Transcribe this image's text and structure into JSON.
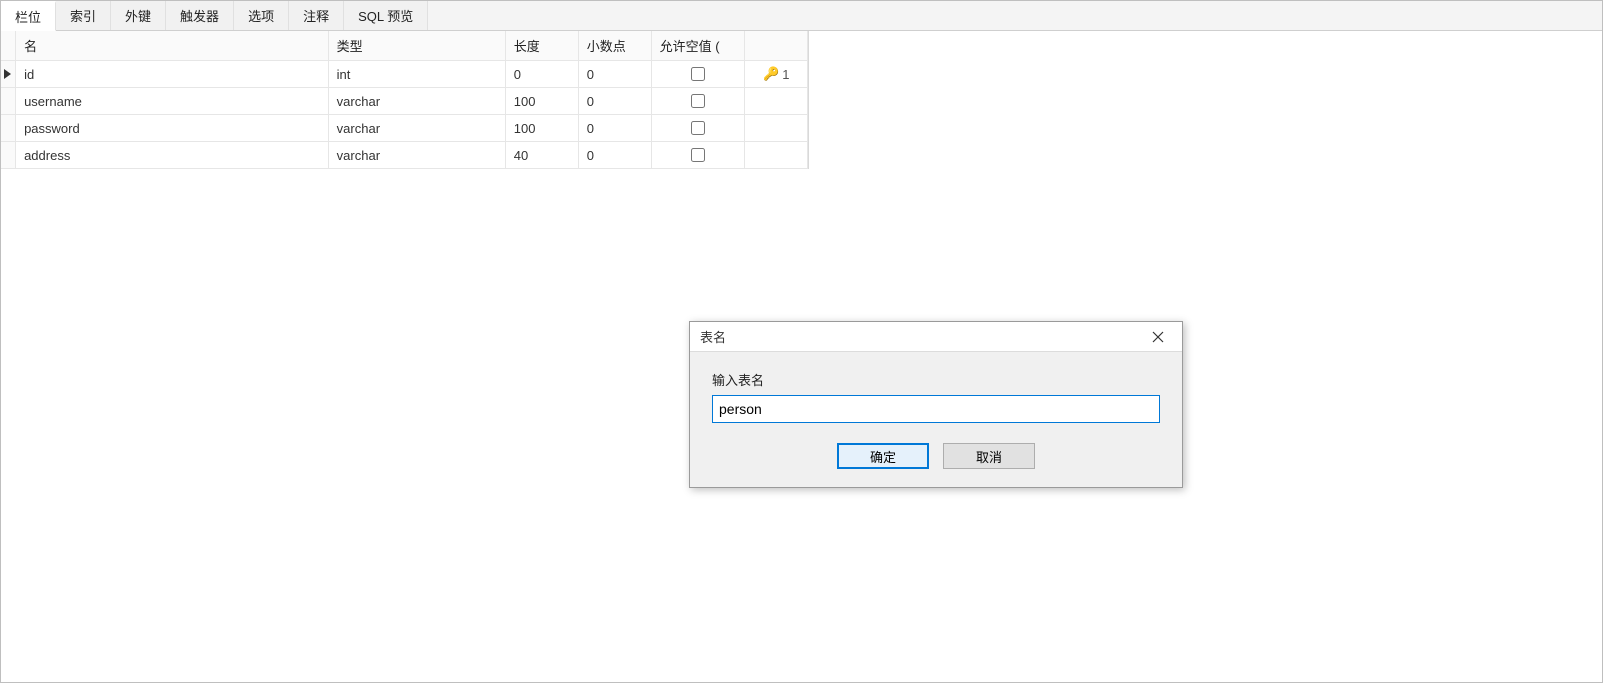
{
  "tabs": {
    "fields": "栏位",
    "indexes": "索引",
    "fkeys": "外键",
    "triggers": "触发器",
    "options": "选项",
    "comment": "注释",
    "sqlprev": "SQL 预览"
  },
  "columns": {
    "name": "名",
    "type": "类型",
    "length": "长度",
    "decimals": "小数点",
    "allow_null": "允许空值 ("
  },
  "rows": [
    {
      "name": "id",
      "type": "int",
      "length": "0",
      "decimals": "0",
      "allow_null": false,
      "pk": "1"
    },
    {
      "name": "username",
      "type": "varchar",
      "length": "100",
      "decimals": "0",
      "allow_null": false,
      "pk": ""
    },
    {
      "name": "password",
      "type": "varchar",
      "length": "100",
      "decimals": "0",
      "allow_null": false,
      "pk": ""
    },
    {
      "name": "address",
      "type": "varchar",
      "length": "40",
      "decimals": "0",
      "allow_null": false,
      "pk": ""
    }
  ],
  "dialog": {
    "title": "表名",
    "label": "输入表名",
    "value": "person",
    "ok": "确定",
    "cancel": "取消"
  }
}
